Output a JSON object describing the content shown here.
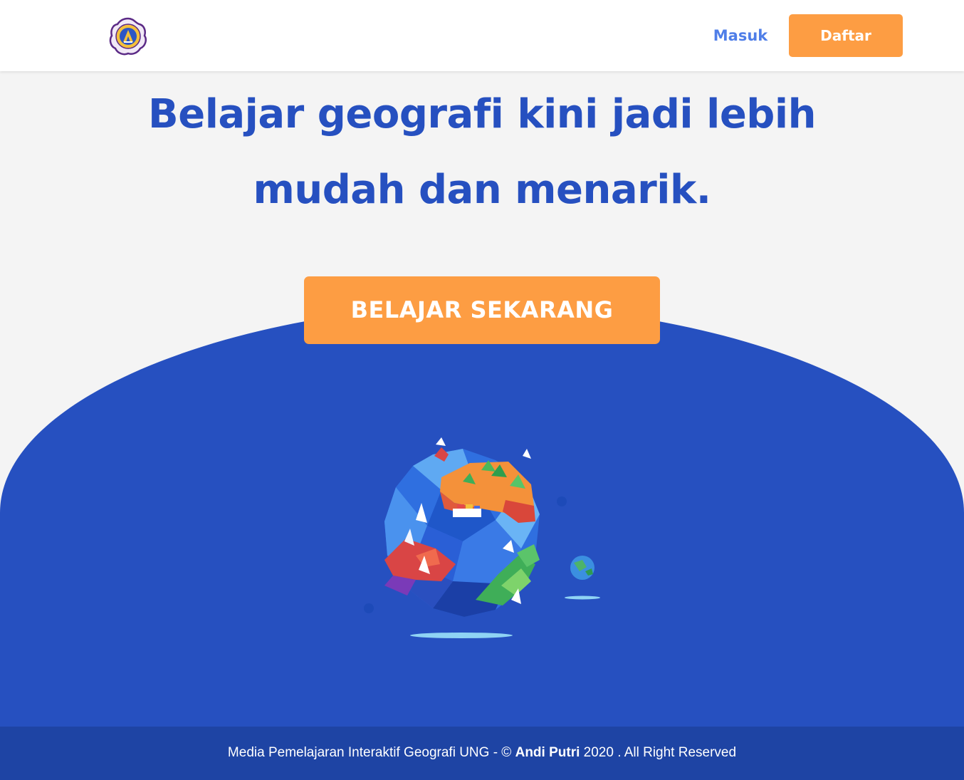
{
  "nav": {
    "login_label": "Masuk",
    "register_label": "Daftar",
    "logo_icon": "university-seal-logo"
  },
  "hero": {
    "title_line1": "Belajar geografi kini jadi lebih",
    "title_line2": "mudah dan menarik.",
    "cta_label": "BELAJAR SEKARANG",
    "illustration_icon": "low-poly-globe-illustration"
  },
  "footer": {
    "text_prefix": "Media Pemelajaran Interaktif Geografi UNG - ©",
    "author": "Andi Putri",
    "text_suffix": "2020 . All Right Reserved"
  },
  "colors": {
    "brand_blue": "#2650c0",
    "accent_orange": "#fd9d43",
    "link_blue": "#4f7ee8",
    "footer_blue": "#1e44a4",
    "page_background": "#f4f4f4"
  }
}
